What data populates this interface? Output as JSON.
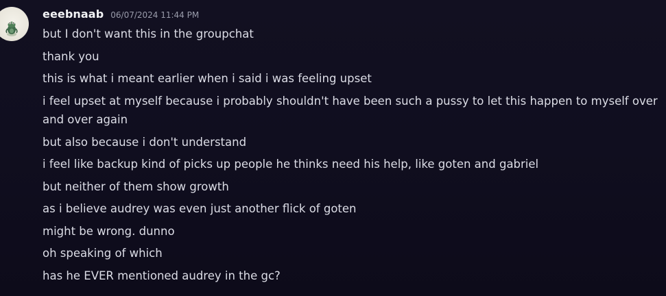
{
  "author": {
    "username": "eeebnaab",
    "timestamp": "06/07/2024 11:44 PM",
    "avatar_icon": "frog-avatar-icon"
  },
  "messages": [
    "but I don't want this in the groupchat",
    "thank you",
    "this is what i meant earlier when i said i was feeling upset",
    "i feel upset at myself because i probably shouldn't have been such a pussy to let this happen to myself over and over again",
    "but also because i don't understand",
    "i feel like backup kind of picks up people he thinks need his help, like goten and gabriel",
    "but neither of them show growth",
    "as i believe audrey was even just another flick of goten",
    "might be wrong. dunno",
    "oh speaking of which",
    "has he EVER mentioned audrey in the gc?"
  ],
  "colors": {
    "background": "#110f20",
    "username": "#f2f3f5",
    "timestamp": "#9a9cab",
    "message_text": "#dcdde6"
  }
}
